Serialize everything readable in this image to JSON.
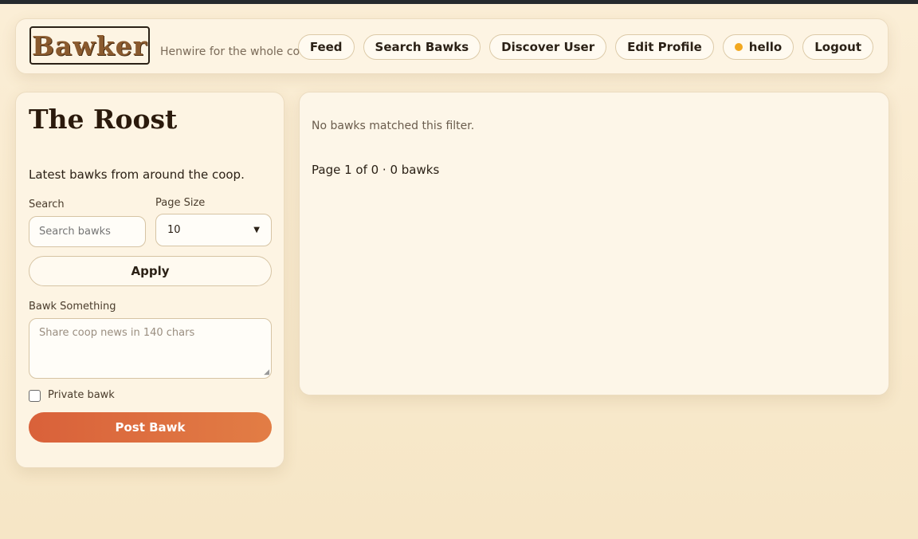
{
  "header": {
    "logo_text": "Bawker",
    "tagline": "Henwire for the whole coop",
    "nav": {
      "feed": "Feed",
      "search_bawks": "Search Bawks",
      "discover_user": "Discover User",
      "edit_profile": "Edit Profile",
      "user": "hello",
      "logout": "Logout"
    }
  },
  "sidebar": {
    "title": "The Roost",
    "subtitle": "Latest bawks from around the coop.",
    "search_label": "Search",
    "search_placeholder": "Search bawks",
    "page_size_label": "Page Size",
    "page_size_value": "10",
    "apply_label": "Apply",
    "compose_label": "Bawk Something",
    "compose_placeholder": "Share coop news in 140 chars",
    "private_label": "Private bawk",
    "post_label": "Post Bawk"
  },
  "main": {
    "empty_text": "No bawks matched this filter.",
    "pager_text": "Page 1 of 0 · 0 bawks"
  },
  "colors": {
    "accent": "#d9613a",
    "status_dot": "#f2a81f"
  }
}
